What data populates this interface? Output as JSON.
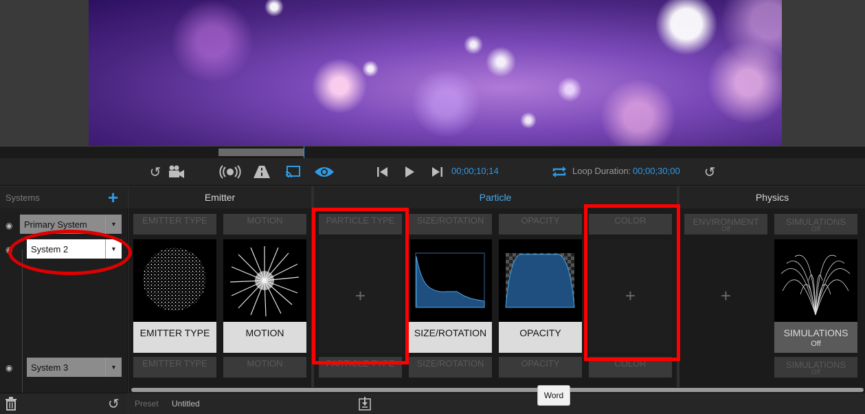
{
  "transport": {
    "timecode": "00;00;10;14",
    "loop_label": "Loop Duration:",
    "loop_value": "00;00;30;00"
  },
  "systems": {
    "title": "Systems",
    "add": "+",
    "items": [
      {
        "label": "Primary System"
      },
      {
        "label": "System 2"
      },
      {
        "label": "System 3"
      }
    ]
  },
  "sections": {
    "emitter": "Emitter",
    "particle": "Particle",
    "physics": "Physics"
  },
  "ghost_top": {
    "emitter_type": "EMITTER TYPE",
    "motion": "MOTION",
    "particle_type": "PARTICLE TYPE",
    "size_rotation": "SIZE/ROTATION",
    "opacity": "OPACITY",
    "color": "COLOR",
    "environment": "ENVIRONMENT",
    "environment_sub": "Off",
    "simulations": "SIMULATIONS",
    "simulations_sub": "Off"
  },
  "cards": {
    "emitter_type": "EMITTER TYPE",
    "motion": "MOTION",
    "size_rotation": "SIZE/ROTATION",
    "opacity": "OPACITY",
    "simulations": "SIMULATIONS",
    "simulations_sub": "Off",
    "plus": "+"
  },
  "ghost_bottom": {
    "emitter_type": "EMITTER TYPE",
    "motion": "MOTION",
    "particle_type": "PARTICLE TYPE",
    "size_rotation": "SIZE/ROTATION",
    "opacity": "OPACITY",
    "color": "COLOR",
    "simulations": "SIMULATIONS",
    "simulations_sub": "Off"
  },
  "footer": {
    "preset_label": "Preset",
    "preset_value": "Untitled",
    "tooltip": "Word"
  },
  "colors": {
    "accent": "#2f9be6",
    "highlight": "#ff0000"
  }
}
